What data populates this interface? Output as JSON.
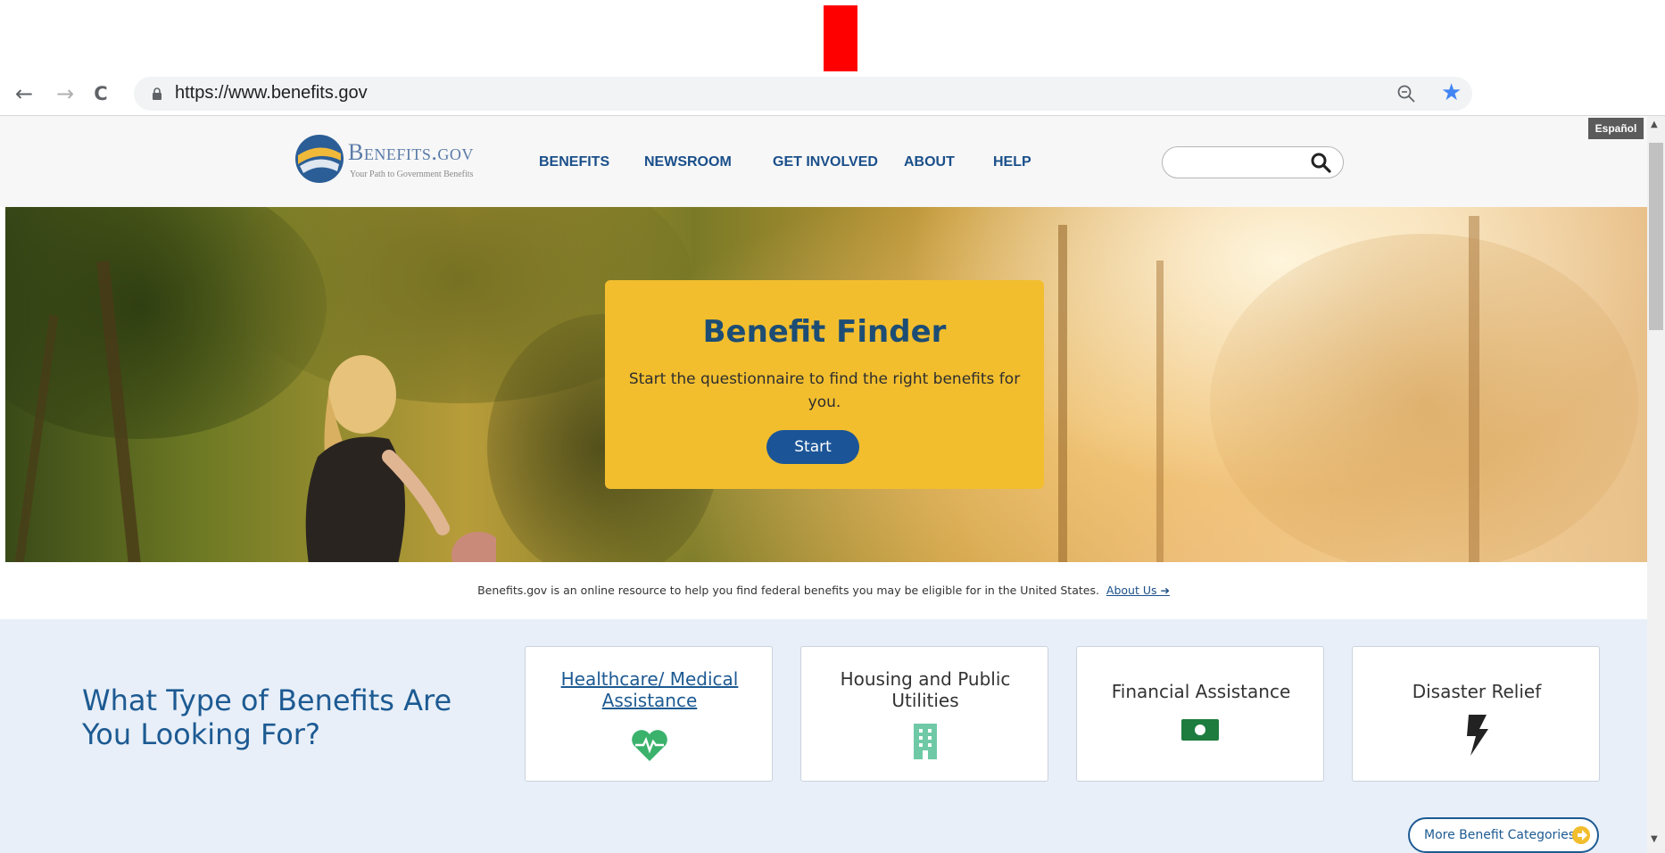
{
  "browser": {
    "url": "https://www.benefits.gov",
    "back_icon": "←",
    "forward_icon": "→",
    "reload_icon": "C",
    "star_icon": "★",
    "scroll_up": "▲",
    "scroll_down": "▼"
  },
  "site": {
    "language_toggle": "Español",
    "logo_title": "Benefits.gov",
    "logo_tagline": "Your Path to Government Benefits",
    "nav": [
      "BENEFITS",
      "NEWSROOM",
      "GET INVOLVED",
      "ABOUT",
      "HELP"
    ],
    "search_placeholder": ""
  },
  "hero": {
    "title": "Benefit Finder",
    "description": "Start the questionnaire to find the right benefits for you.",
    "button": "Start",
    "card_color": "#f2be2e"
  },
  "intro": {
    "text": "Benefits.gov is an online resource to help you find federal benefits you may be eligible for in the United States.",
    "link": "About Us ➔"
  },
  "categories": {
    "heading": "What Type of Benefits Are You Looking For?",
    "items": [
      {
        "label": "Healthcare/ Medical Assistance",
        "icon": "heart-pulse-icon",
        "color": "#3bb26c",
        "link": true
      },
      {
        "label": "Housing and Public Utilities",
        "icon": "building-icon",
        "color": "#6fc9a6",
        "link": false
      },
      {
        "label": "Financial Assistance",
        "icon": "money-icon",
        "color": "#1e7c3e",
        "link": false
      },
      {
        "label": "Disaster Relief",
        "icon": "lightning-icon",
        "color": "#222222",
        "link": false
      }
    ],
    "more_button": "More Benefit Categories"
  },
  "colors": {
    "brand_blue": "#1d5a92",
    "nav_blue": "#1a4f8a",
    "annotation_red": "#ff0000"
  }
}
